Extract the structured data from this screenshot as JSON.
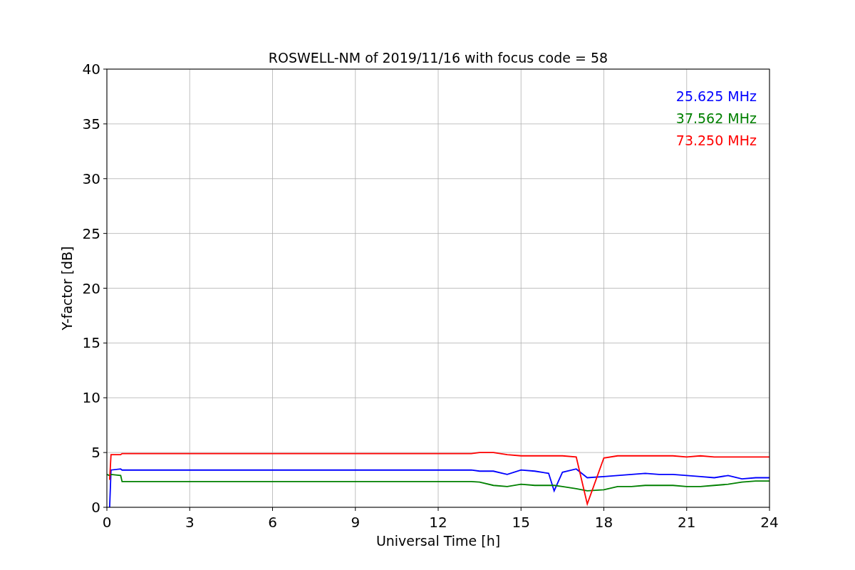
{
  "chart": {
    "chart_data": {
      "type": "line",
      "title": "ROSWELL-NM of 2019/11/16 with focus code = 58",
      "xlabel": "Universal Time [h]",
      "ylabel": "Y-factor [dB]",
      "x": [
        0,
        0.1,
        0.15,
        0.5,
        0.55,
        13.2,
        13.5,
        14,
        14.5,
        15,
        15.5,
        16,
        16.2,
        16.5,
        17,
        17.4,
        18,
        18.5,
        19,
        19.5,
        20,
        20.5,
        21,
        21.5,
        22,
        22.5,
        23,
        23.5,
        24
      ],
      "series": [
        {
          "name": "25.625 MHz",
          "color": "#0000ff",
          "values": [
            null,
            0,
            3.4,
            3.5,
            3.4,
            3.4,
            3.3,
            3.3,
            3.0,
            3.4,
            3.3,
            3.1,
            1.5,
            3.2,
            3.5,
            2.7,
            2.8,
            2.9,
            3.0,
            3.1,
            3.0,
            3.0,
            2.9,
            2.8,
            2.7,
            2.9,
            2.6,
            2.7,
            2.7
          ]
        },
        {
          "name": "37.562 MHz",
          "color": "#008000",
          "values": [
            3.0,
            2.9,
            3.0,
            2.9,
            2.35,
            2.35,
            2.3,
            2.0,
            1.9,
            2.1,
            2.0,
            2.0,
            2.0,
            1.9,
            1.7,
            1.5,
            1.6,
            1.9,
            1.9,
            2.0,
            2.0,
            2.0,
            1.9,
            1.9,
            2.0,
            2.1,
            2.3,
            2.4,
            2.4
          ]
        },
        {
          "name": "73.250 MHz",
          "color": "#ff0000",
          "values": [
            null,
            2.5,
            4.8,
            4.8,
            4.9,
            4.9,
            5.0,
            5.0,
            4.8,
            4.7,
            4.7,
            4.7,
            4.7,
            4.7,
            4.6,
            0.3,
            4.5,
            4.7,
            4.7,
            4.7,
            4.7,
            4.7,
            4.6,
            4.7,
            4.6,
            4.6,
            4.6,
            4.6,
            4.6
          ]
        }
      ],
      "xlim": [
        0,
        24
      ],
      "ylim": [
        0,
        40
      ],
      "xticks": [
        0,
        3,
        6,
        9,
        12,
        15,
        18,
        21,
        24
      ],
      "yticks": [
        0,
        5,
        10,
        15,
        20,
        25,
        30,
        35,
        40
      ],
      "grid": true
    }
  }
}
